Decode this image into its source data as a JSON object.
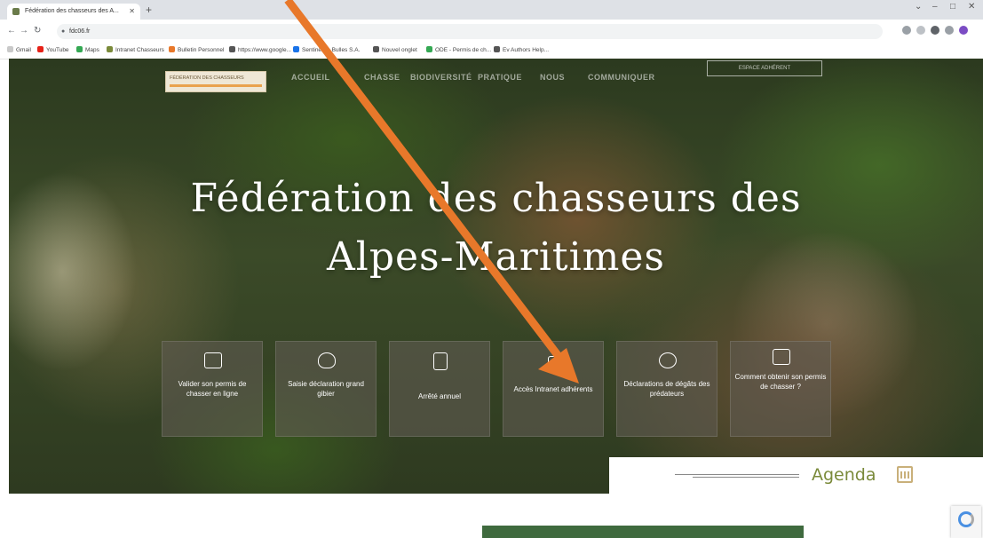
{
  "browser": {
    "tab_title": "Fédération des chasseurs des A...",
    "url": "fdc06.fr",
    "bookmarks": [
      "Gmail",
      "YouTube",
      "Maps",
      "Intranet Chasseurs",
      "Bulletin Personnel",
      "https://www.google...",
      "Sentinelles Bulles S.A.",
      "Nouvel onglet",
      "ODE - Permis de ch...",
      "Ev Authors Help..."
    ]
  },
  "site": {
    "logo_text": "FÉDÉRATION DES CHASSEURS",
    "nav": [
      "ACCUEIL",
      "CHASSE",
      "BIODIVERSITÉ",
      "PRATIQUE",
      "NOUS",
      "COMMUNIQUER"
    ],
    "nav_cta": "ESPACE ADHÉRENT",
    "title_line1": "Fédération des chasseurs des",
    "title_line2": "Alpes-Maritimes",
    "tiles": [
      {
        "label": "Valider son permis de chasser en ligne",
        "icon": "permit-icon"
      },
      {
        "label": "Saisie déclaration grand gibier",
        "icon": "boar-icon"
      },
      {
        "label": "Arrêté annuel",
        "icon": "document-icon"
      },
      {
        "label": "Accès Intranet adhérents",
        "icon": "lock-icon"
      },
      {
        "label": "Déclarations de dégâts des prédateurs",
        "icon": "wolf-icon"
      },
      {
        "label": "Comment obtenir son permis de chasser ?",
        "icon": "question-icon"
      }
    ],
    "agenda_label": "Agenda"
  },
  "colors": {
    "accent_green": "#3f6a3e",
    "agenda_text": "#7a8a3a",
    "arrow": "#e8782a"
  }
}
